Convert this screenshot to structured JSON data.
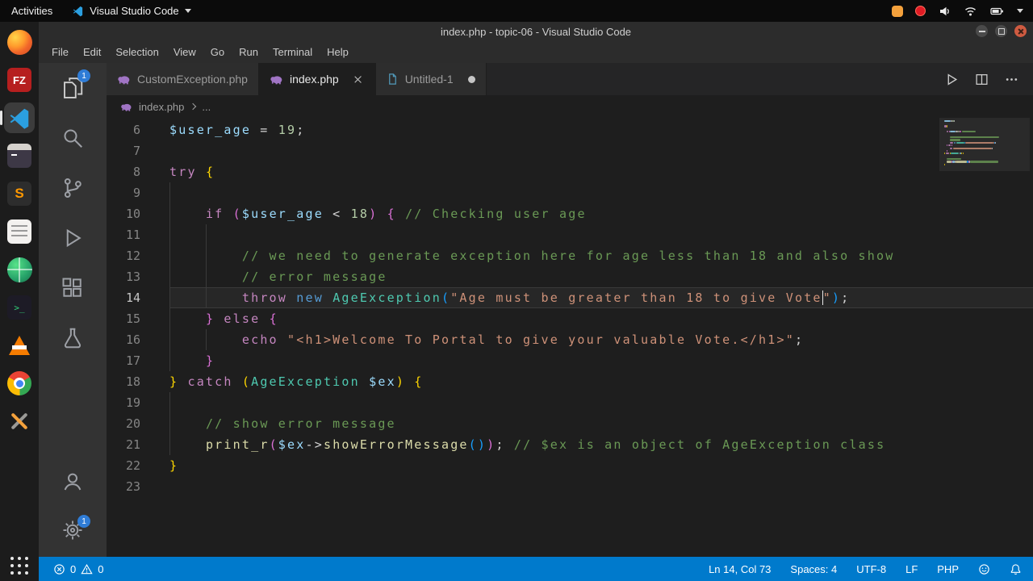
{
  "system_bar": {
    "activities_label": "Activities",
    "app_menu_label": "Visual Studio Code"
  },
  "window": {
    "title": "index.php - topic-06 - Visual Studio Code"
  },
  "menubar": [
    "File",
    "Edit",
    "Selection",
    "View",
    "Go",
    "Run",
    "Terminal",
    "Help"
  ],
  "dock": {
    "filezilla_label": "FZ",
    "sublime_label": "S",
    "terminal_glyph": ">_"
  },
  "activity_bar": {
    "explorer_badge": "1",
    "settings_badge": "1"
  },
  "tabs": [
    {
      "label": "CustomException.php",
      "active": false,
      "modified": false
    },
    {
      "label": "index.php",
      "active": true,
      "modified": false
    },
    {
      "label": "Untitled-1",
      "active": false,
      "modified": true
    }
  ],
  "breadcrumb": {
    "file": "index.php",
    "more": "..."
  },
  "editor": {
    "active_line": 14,
    "lines": [
      {
        "num": 6,
        "guides": [],
        "tokens": [
          [
            "var",
            "$user_age"
          ],
          [
            "pl",
            " = "
          ],
          [
            "num",
            "19"
          ],
          [
            "pl",
            ";"
          ]
        ]
      },
      {
        "num": 7,
        "guides": [],
        "tokens": []
      },
      {
        "num": 8,
        "guides": [],
        "tokens": [
          [
            "kw",
            "try"
          ],
          [
            "pl",
            " "
          ],
          [
            "b0",
            "{"
          ]
        ]
      },
      {
        "num": 9,
        "guides": [
          0
        ],
        "tokens": []
      },
      {
        "num": 10,
        "guides": [
          0
        ],
        "tokens": [
          [
            "pl",
            "    "
          ],
          [
            "kw",
            "if"
          ],
          [
            "pl",
            " "
          ],
          [
            "b1",
            "("
          ],
          [
            "var",
            "$user_age"
          ],
          [
            "pl",
            " < "
          ],
          [
            "num",
            "18"
          ],
          [
            "b1",
            ")"
          ],
          [
            "pl",
            " "
          ],
          [
            "b1",
            "{"
          ],
          [
            "pl",
            " "
          ],
          [
            "com",
            "// Checking user age"
          ]
        ]
      },
      {
        "num": 11,
        "guides": [
          0,
          4
        ],
        "tokens": []
      },
      {
        "num": 12,
        "guides": [
          0,
          4
        ],
        "tokens": [
          [
            "pl",
            "        "
          ],
          [
            "com",
            "// we need to generate exception here for age less than 18 and also show"
          ]
        ]
      },
      {
        "num": 13,
        "guides": [
          0,
          4
        ],
        "tokens": [
          [
            "pl",
            "        "
          ],
          [
            "com",
            "// error message"
          ]
        ]
      },
      {
        "num": 14,
        "guides": [
          0,
          4
        ],
        "tokens": [
          [
            "pl",
            "        "
          ],
          [
            "kw",
            "throw"
          ],
          [
            "pl",
            " "
          ],
          [
            "kw2",
            "new"
          ],
          [
            "pl",
            " "
          ],
          [
            "cls",
            "AgeException"
          ],
          [
            "b2",
            "("
          ],
          [
            "str",
            "\"Age must be greater than 18 to give Vote"
          ],
          [
            "cur",
            ""
          ],
          [
            "str",
            "\""
          ],
          [
            "b2",
            ")"
          ],
          [
            "pl",
            ";"
          ]
        ]
      },
      {
        "num": 15,
        "guides": [
          0
        ],
        "tokens": [
          [
            "pl",
            "    "
          ],
          [
            "b1",
            "}"
          ],
          [
            "pl",
            " "
          ],
          [
            "kw",
            "else"
          ],
          [
            "pl",
            " "
          ],
          [
            "b1",
            "{"
          ]
        ]
      },
      {
        "num": 16,
        "guides": [
          0,
          4
        ],
        "tokens": [
          [
            "pl",
            "        "
          ],
          [
            "kw",
            "echo"
          ],
          [
            "pl",
            " "
          ],
          [
            "str",
            "\"<h1>Welcome To Portal to give your valuable Vote.</h1>\""
          ],
          [
            "pl",
            ";"
          ]
        ]
      },
      {
        "num": 17,
        "guides": [
          0
        ],
        "tokens": [
          [
            "pl",
            "    "
          ],
          [
            "b1",
            "}"
          ]
        ]
      },
      {
        "num": 18,
        "guides": [],
        "tokens": [
          [
            "b0",
            "}"
          ],
          [
            "pl",
            " "
          ],
          [
            "kw",
            "catch"
          ],
          [
            "pl",
            " "
          ],
          [
            "b0",
            "("
          ],
          [
            "cls",
            "AgeException"
          ],
          [
            "pl",
            " "
          ],
          [
            "var",
            "$ex"
          ],
          [
            "b0",
            ")"
          ],
          [
            "pl",
            " "
          ],
          [
            "b0",
            "{"
          ]
        ]
      },
      {
        "num": 19,
        "guides": [
          0
        ],
        "tokens": []
      },
      {
        "num": 20,
        "guides": [
          0
        ],
        "tokens": [
          [
            "pl",
            "    "
          ],
          [
            "com",
            "// show error message"
          ]
        ]
      },
      {
        "num": 21,
        "guides": [
          0
        ],
        "tokens": [
          [
            "pl",
            "    "
          ],
          [
            "fn",
            "print_r"
          ],
          [
            "b1",
            "("
          ],
          [
            "var",
            "$ex"
          ],
          [
            "pl",
            "->"
          ],
          [
            "fn",
            "showErrorMessage"
          ],
          [
            "b2",
            "("
          ],
          [
            "b2",
            ")"
          ],
          [
            "b1",
            ")"
          ],
          [
            "pl",
            ";"
          ],
          [
            "pl",
            " "
          ],
          [
            "com",
            "// $ex is an object of AgeException class"
          ]
        ]
      },
      {
        "num": 22,
        "guides": [],
        "tokens": [
          [
            "b0",
            "}"
          ]
        ]
      },
      {
        "num": 23,
        "guides": [],
        "tokens": []
      }
    ]
  },
  "status_bar": {
    "errors": "0",
    "warnings": "0",
    "cursor_position": "Ln 14, Col 73",
    "indentation": "Spaces: 4",
    "encoding": "UTF-8",
    "eol": "LF",
    "language": "PHP"
  }
}
